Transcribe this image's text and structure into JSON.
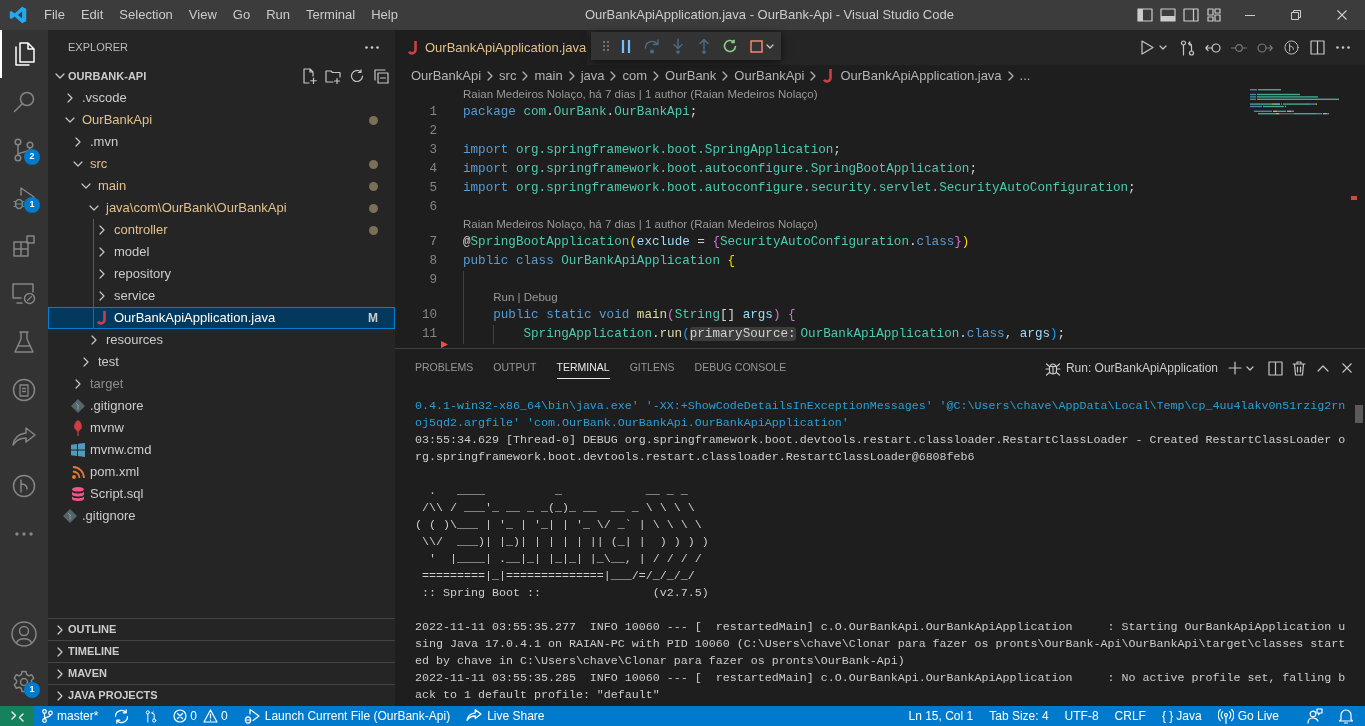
{
  "title_bar": {
    "menu": [
      "File",
      "Edit",
      "Selection",
      "View",
      "Go",
      "Run",
      "Terminal",
      "Help"
    ],
    "title": "OurBankApiApplication.java - OurBank-Api - Visual Studio Code"
  },
  "activity_bar": {
    "items": [
      {
        "kind": "explorer",
        "selected": true
      },
      {
        "kind": "search",
        "selected": false
      },
      {
        "kind": "source-control",
        "selected": false,
        "badge": "2"
      },
      {
        "kind": "run-debug",
        "selected": false,
        "badge": "1"
      },
      {
        "kind": "extensions",
        "selected": false
      },
      {
        "kind": "remote-explorer",
        "selected": false
      },
      {
        "kind": "testing",
        "selected": false
      },
      {
        "kind": "repository",
        "selected": false
      },
      {
        "kind": "live-share",
        "selected": false
      },
      {
        "kind": "gitlens",
        "selected": false
      }
    ],
    "settings_badge": "1"
  },
  "sidebar": {
    "title": "EXPLORER",
    "root": {
      "label": "OURBANK-API",
      "expanded": true
    },
    "tree": [
      {
        "label": ".vscode",
        "kind": "folder",
        "expanded": false,
        "modified": false,
        "ignored": false,
        "selected": false
      },
      {
        "label": "OurBankApi",
        "kind": "folder",
        "expanded": true,
        "modified": true,
        "ignored": false,
        "selected": false,
        "children": [
          {
            "label": ".mvn",
            "kind": "folder",
            "expanded": false,
            "modified": false,
            "ignored": false,
            "selected": false
          },
          {
            "label": "src",
            "kind": "folder",
            "expanded": true,
            "modified": true,
            "ignored": false,
            "selected": false,
            "children": [
              {
                "label": "main",
                "kind": "folder",
                "expanded": true,
                "modified": true,
                "ignored": false,
                "selected": false,
                "children": [
                  {
                    "label": "java\\com\\OurBank\\OurBankApi",
                    "kind": "folder",
                    "expanded": true,
                    "modified": true,
                    "ignored": false,
                    "selected": false,
                    "children": [
                      {
                        "label": "controller",
                        "kind": "folder",
                        "expanded": false,
                        "modified": true,
                        "ignored": false,
                        "selected": false
                      },
                      {
                        "label": "model",
                        "kind": "folder",
                        "expanded": false,
                        "modified": false,
                        "ignored": false,
                        "selected": false
                      },
                      {
                        "label": "repository",
                        "kind": "folder",
                        "expanded": false,
                        "modified": false,
                        "ignored": false,
                        "selected": false
                      },
                      {
                        "label": "service",
                        "kind": "folder",
                        "expanded": false,
                        "modified": false,
                        "ignored": false,
                        "selected": false
                      },
                      {
                        "label": "OurBankApiApplication.java",
                        "kind": "java",
                        "selected": true,
                        "badge": "M"
                      }
                    ]
                  },
                  {
                    "label": "resources",
                    "kind": "folder",
                    "expanded": false,
                    "modified": false,
                    "ignored": false,
                    "selected": false
                  }
                ]
              },
              {
                "label": "test",
                "kind": "folder",
                "expanded": false,
                "modified": false,
                "ignored": false,
                "selected": false
              }
            ]
          },
          {
            "label": "target",
            "kind": "folder",
            "expanded": false,
            "modified": false,
            "ignored": true,
            "selected": false
          },
          {
            "label": ".gitignore",
            "kind": "git",
            "modified": false,
            "ignored": false,
            "selected": false
          },
          {
            "label": "mvnw",
            "kind": "maven",
            "modified": false,
            "ignored": false,
            "selected": false
          },
          {
            "label": "mvnw.cmd",
            "kind": "windows",
            "modified": false,
            "ignored": false,
            "selected": false
          },
          {
            "label": "pom.xml",
            "kind": "xml",
            "modified": false,
            "ignored": false,
            "selected": false
          },
          {
            "label": "Script.sql",
            "kind": "sql",
            "modified": false,
            "ignored": false,
            "selected": false
          }
        ]
      },
      {
        "label": ".gitignore",
        "kind": "git",
        "modified": false,
        "ignored": false,
        "selected": false
      }
    ],
    "sections": [
      {
        "label": "OUTLINE",
        "expanded": false
      },
      {
        "label": "TIMELINE",
        "expanded": false
      },
      {
        "label": "MAVEN",
        "expanded": false
      },
      {
        "label": "JAVA PROJECTS",
        "expanded": false
      }
    ]
  },
  "editor": {
    "tab": {
      "label": "OurBankApiApplication.java",
      "kind": "java",
      "selected": true,
      "modified": true
    },
    "debug_toolbar": [
      {
        "kind": "pause",
        "disabled": false
      },
      {
        "kind": "step-over",
        "disabled": true
      },
      {
        "kind": "step-into",
        "disabled": true
      },
      {
        "kind": "step-out",
        "disabled": true
      },
      {
        "kind": "restart",
        "disabled": false
      },
      {
        "kind": "stop",
        "disabled": false
      }
    ],
    "breadcrumbs": [
      {
        "label": "OurBankApi",
        "kind": "folder"
      },
      {
        "label": "src",
        "kind": "folder"
      },
      {
        "label": "main",
        "kind": "folder"
      },
      {
        "label": "java",
        "kind": "folder"
      },
      {
        "label": "com",
        "kind": "folder"
      },
      {
        "label": "OurBank",
        "kind": "folder"
      },
      {
        "label": "OurBankApi",
        "kind": "folder"
      },
      {
        "label": "OurBankApiApplication.java",
        "kind": "java"
      },
      {
        "label": "...",
        "kind": "symbol"
      }
    ],
    "lines": [
      {
        "kind": "lens",
        "text": "Raian Medeiros Nolaço, há 7 dias | 1 author (Raian Medeiros Nolaço)"
      },
      {
        "kind": "code",
        "number": "1",
        "tokens": [
          {
            "text": "package",
            "kind": "keyword"
          },
          {
            "text": " com",
            "kind": "namespace"
          },
          {
            "text": ".",
            "kind": "plain"
          },
          {
            "text": "OurBank",
            "kind": "namespace"
          },
          {
            "text": ".",
            "kind": "plain"
          },
          {
            "text": "OurBankApi",
            "kind": "namespace"
          },
          {
            "text": ";",
            "kind": "plain"
          }
        ]
      },
      {
        "kind": "code",
        "number": "2"
      },
      {
        "kind": "code",
        "number": "3",
        "tokens": [
          {
            "text": "import",
            "kind": "keyword"
          },
          {
            "text": " org.springframework.boot.",
            "kind": "namespace"
          },
          {
            "text": "SpringApplication",
            "kind": "type"
          },
          {
            "text": ";",
            "kind": "plain"
          }
        ]
      },
      {
        "kind": "code",
        "number": "4",
        "tokens": [
          {
            "text": "import",
            "kind": "keyword"
          },
          {
            "text": " org.springframework.boot.autoconfigure.",
            "kind": "namespace"
          },
          {
            "text": "SpringBootApplication",
            "kind": "type"
          },
          {
            "text": ";",
            "kind": "plain"
          }
        ]
      },
      {
        "kind": "code",
        "number": "5",
        "tokens": [
          {
            "text": "import",
            "kind": "keyword"
          },
          {
            "text": " org.springframework.boot.autoconfigure.security.servlet.",
            "kind": "namespace"
          },
          {
            "text": "SecurityAutoConfiguration",
            "kind": "type"
          },
          {
            "text": ";",
            "kind": "plain"
          }
        ]
      },
      {
        "kind": "code",
        "number": "6"
      },
      {
        "kind": "lens",
        "text": "Raian Medeiros Nolaço, há 7 dias | 1 author (Raian Medeiros Nolaço)"
      },
      {
        "kind": "code",
        "number": "7",
        "tokens": [
          {
            "text": "@",
            "kind": "plain"
          },
          {
            "text": "SpringBootApplication",
            "kind": "type"
          },
          {
            "text": "(",
            "kind": "bracket1"
          },
          {
            "text": "exclude",
            "kind": "param"
          },
          {
            "text": " = ",
            "kind": "plain"
          },
          {
            "text": "{",
            "kind": "bracket2"
          },
          {
            "text": "SecurityAutoConfiguration",
            "kind": "type"
          },
          {
            "text": ".",
            "kind": "plain"
          },
          {
            "text": "class",
            "kind": "keyword"
          },
          {
            "text": "}",
            "kind": "bracket2"
          },
          {
            "text": ")",
            "kind": "bracket1"
          }
        ]
      },
      {
        "kind": "code",
        "number": "8",
        "tokens": [
          {
            "text": "public class ",
            "kind": "keyword"
          },
          {
            "text": "OurBankApiApplication ",
            "kind": "type"
          },
          {
            "text": "{",
            "kind": "bracket1"
          }
        ]
      },
      {
        "kind": "code",
        "number": "9"
      },
      {
        "kind": "lens",
        "text": "Run | Debug"
      },
      {
        "kind": "code",
        "number": "10",
        "tokens": [
          {
            "text": "    public static void ",
            "kind": "keyword"
          },
          {
            "text": "main",
            "kind": "function"
          },
          {
            "text": "(",
            "kind": "bracket2"
          },
          {
            "text": "String",
            "kind": "type"
          },
          {
            "text": "[] ",
            "kind": "plain"
          },
          {
            "text": "args",
            "kind": "param"
          },
          {
            "text": ") {",
            "kind": "bracket2"
          }
        ]
      },
      {
        "kind": "code",
        "number": "11",
        "git_deleted": true,
        "tokens": [
          {
            "text": "        SpringApplication",
            "kind": "type"
          },
          {
            "text": ".",
            "kind": "plain"
          },
          {
            "text": "run",
            "kind": "function"
          },
          {
            "text": "(",
            "kind": "bracket3"
          },
          {
            "text": "primarySource:",
            "kind": "hint"
          },
          {
            "text": "OurBankApiApplication",
            "kind": "type"
          },
          {
            "text": ".",
            "kind": "plain"
          },
          {
            "text": "class",
            "kind": "keyword"
          },
          {
            "text": ", ",
            "kind": "plain"
          },
          {
            "text": "args",
            "kind": "param"
          },
          {
            "text": ")",
            "kind": "bracket3"
          },
          {
            "text": ";",
            "kind": "plain"
          }
        ]
      }
    ]
  },
  "panel": {
    "tabs": [
      {
        "label": "PROBLEMS",
        "selected": false
      },
      {
        "label": "OUTPUT",
        "selected": false
      },
      {
        "label": "TERMINAL",
        "selected": true
      },
      {
        "label": "GITLENS",
        "selected": false
      },
      {
        "label": "DEBUG CONSOLE",
        "selected": false
      }
    ],
    "terminal_name": "Run: OurBankApiApplication",
    "terminal": [
      {
        "kind": "command",
        "text": "0.4.1-win32-x86_64\\bin\\java.exe' '-XX:+ShowCodeDetailsInExceptionMessages' '@C:\\Users\\chave\\AppData\\Local\\Temp\\cp_4uu4lakv0n51rzig2rn"
      },
      {
        "kind": "command",
        "text": "oj5qd2.argfile' 'com.OurBank.OurBankApi.OurBankApiApplication'"
      },
      {
        "kind": "output",
        "text": "03:55:34.629 [Thread-0] DEBUG org.springframework.boot.devtools.restart.classloader.RestartClassLoader - Created RestartClassLoader o"
      },
      {
        "kind": "output",
        "text": "rg.springframework.boot.devtools.restart.classloader.RestartClassLoader@6808feb6"
      },
      {
        "kind": "blank"
      },
      {
        "kind": "output",
        "text": "  .   ____          _            __ _ _"
      },
      {
        "kind": "output",
        "text": " /\\\\ / ___'_ __ _ _(_)_ __  __ _ \\ \\ \\ \\"
      },
      {
        "kind": "output",
        "text": "( ( )\\___ | '_ | '_| | '_ \\/ _` | \\ \\ \\ \\"
      },
      {
        "kind": "output",
        "text": " \\\\/  ___)| |_)| | | | | || (_| |  ) ) ) )"
      },
      {
        "kind": "output",
        "text": "  '  |____| .__|_| |_|_| |_\\__, | / / / /"
      },
      {
        "kind": "output",
        "text": " =========|_|==============|___/=/_/_/_/"
      },
      {
        "kind": "output",
        "text": " :: Spring Boot ::                (v2.7.5)"
      },
      {
        "kind": "blank"
      },
      {
        "kind": "output",
        "text": "2022-11-11 03:55:35.277  INFO 10060 --- [  restartedMain] c.O.OurBankApi.OurBankApiApplication     : Starting OurBankApiApplication u"
      },
      {
        "kind": "output",
        "text": "sing Java 17.0.4.1 on RAIAN-PC with PID 10060 (C:\\Users\\chave\\Clonar para fazer os pronts\\OurBank-Api\\OurBankApi\\target\\classes start"
      },
      {
        "kind": "output",
        "text": "ed by chave in C:\\Users\\chave\\Clonar para fazer os pronts\\OurBank-Api)"
      },
      {
        "kind": "output",
        "text": "2022-11-11 03:55:35.285  INFO 10060 --- [  restartedMain] c.O.OurBankApi.OurBankApiApplication     : No active profile set, falling b"
      },
      {
        "kind": "output",
        "text": "ack to 1 default profile: \"default\""
      }
    ]
  },
  "status_bar": {
    "branch": "master*",
    "errors": "0",
    "warnings": "0",
    "launch": "Launch Current File (OurBank-Api)",
    "live_share": "Live Share",
    "right": [
      {
        "kind": "text",
        "label": "Ln 15, Col 1"
      },
      {
        "kind": "text",
        "label": "Tab Size: 4"
      },
      {
        "kind": "text",
        "label": "UTF-8"
      },
      {
        "kind": "text",
        "label": "CRLF"
      },
      {
        "kind": "language",
        "glyph": "{ }",
        "label": "Java"
      },
      {
        "kind": "go-live",
        "label": "Go Live"
      }
    ]
  }
}
